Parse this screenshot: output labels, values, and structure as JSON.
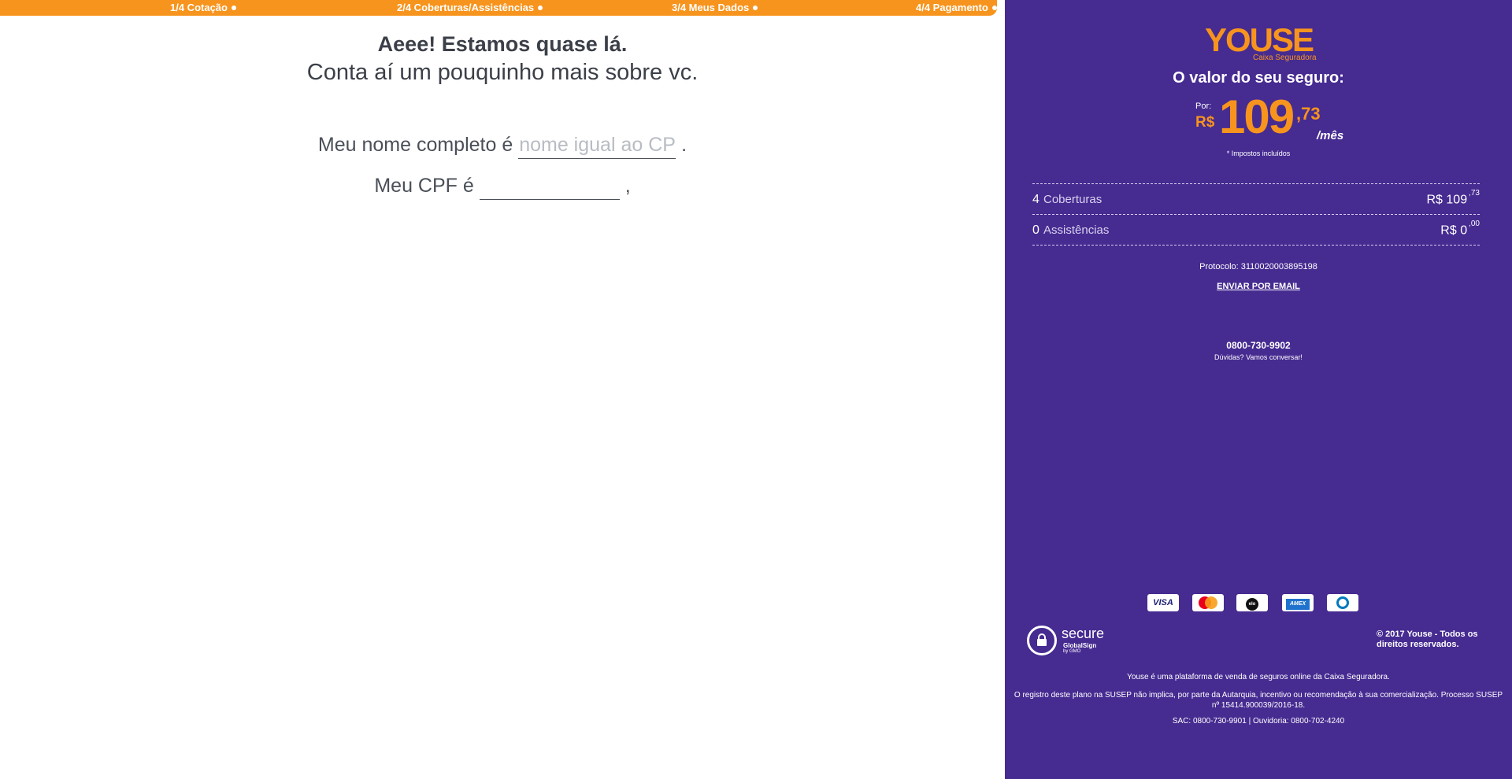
{
  "progress": {
    "steps": [
      {
        "label": "1/4 Cotação"
      },
      {
        "label": "2/4 Coberturas/Assistências"
      },
      {
        "label": "3/4 Meus Dados"
      },
      {
        "label": "4/4 Pagamento"
      }
    ],
    "color": "#f7941d"
  },
  "main": {
    "heading": "Aeee! Estamos quase lá.",
    "subheading": "Conta aí um pouquinho mais sobre vc.",
    "name_row": {
      "label": "Meu nome completo é",
      "placeholder": "nome igual ao CPF",
      "value": "",
      "suffix": "."
    },
    "cpf_row": {
      "label": "Meu CPF é",
      "placeholder": "",
      "value": "",
      "suffix": ","
    }
  },
  "sidebar": {
    "background": "#462b91",
    "accent": "#f7941d",
    "logo": {
      "word": "YOUSE",
      "subtitle": "Caixa Seguradora"
    },
    "price_title": "O valor do seu seguro:",
    "price": {
      "prefix": "Por:",
      "currency": "R$",
      "integer": "109",
      "cents": ",73",
      "unit": "/mês"
    },
    "taxes_note": "* Impostos incluídos",
    "summary": [
      {
        "count": "4",
        "label": "Coberturas",
        "value": "R$ 109",
        "cents": ",73"
      },
      {
        "count": "0",
        "label": "Assistências",
        "value": "R$ 0",
        "cents": ",00"
      }
    ],
    "protocol": "Protocolo: 3110020003895198",
    "send_email": "ENVIAR POR EMAIL",
    "phone": "0800-730-9902",
    "phone_sub": "Dúvidas? Vamos conversar!",
    "cards": [
      {
        "name": "visa-icon",
        "text": "VISA"
      },
      {
        "name": "mastercard-icon",
        "text": ""
      },
      {
        "name": "elo-icon",
        "text": "elo"
      },
      {
        "name": "amex-icon",
        "text": "AMEX"
      },
      {
        "name": "diners-icon",
        "text": ""
      }
    ],
    "secure": {
      "word": "secure",
      "brand": "GlobalSign",
      "gmo": "by GMO"
    },
    "copyright": "© 2017 Youse - Todos os direitos reservados.",
    "footer_1": "Youse é uma plataforma de venda de seguros online da Caixa Seguradora.",
    "footer_2": "O registro deste plano na SUSEP não implica, por parte da Autarquia, incentivo ou recomendação à sua comercialização. Processo SUSEP nº 15414.900039/2016-18.",
    "footer_3": "SAC: 0800-730-9901 | Ouvidoria: 0800-702-4240"
  }
}
